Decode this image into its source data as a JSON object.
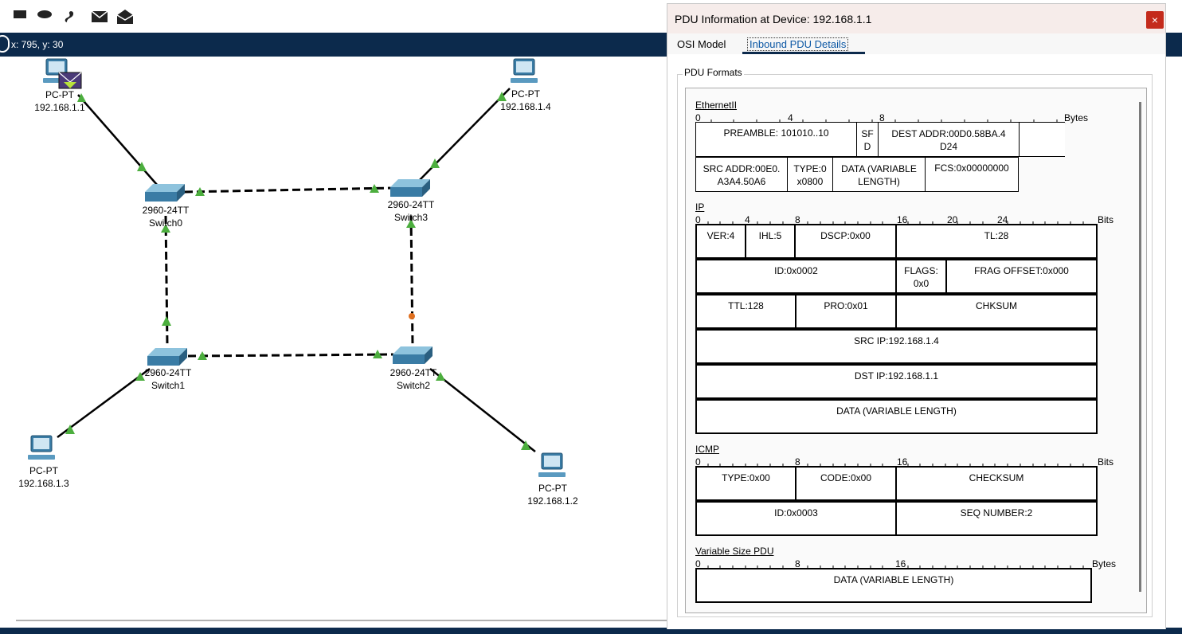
{
  "toolbar": {
    "icons": [
      "rectangle-icon",
      "ellipse-icon",
      "freeform-icon",
      "simple-pdu-icon",
      "complex-pdu-icon"
    ]
  },
  "status": {
    "coords": "x: 795, y: 30"
  },
  "devices": [
    {
      "type": "PC-PT",
      "ip": "192.168.1.1"
    },
    {
      "type": "PC-PT",
      "ip": "192.168.1.4"
    },
    {
      "type": "PC-PT",
      "ip": "192.168.1.3"
    },
    {
      "type": "PC-PT",
      "ip": "192.168.1.2"
    }
  ],
  "switches": [
    {
      "model": "2960-24TT",
      "name": "Switch0"
    },
    {
      "model": "2960-24TT",
      "name": "Switch3"
    },
    {
      "model": "2960-24TT",
      "name": "Switch1"
    },
    {
      "model": "2960-24TT",
      "name": "Switch2"
    }
  ],
  "colors": {
    "link_up": "#4cae3e",
    "link_blocking": "#e07020",
    "dark_bar": "#0c2a4c",
    "close": "#c42b1c"
  },
  "pdu": {
    "title": "PDU Information at Device: 192.168.1.1",
    "close": "×",
    "tabs": [
      "OSI Model",
      "Inbound PDU Details"
    ],
    "group": "PDU Formats",
    "ethernet": {
      "title": "EthernetII",
      "ruler": [
        "0",
        "4",
        "8"
      ],
      "unit": "Bytes",
      "fields": [
        "PREAMBLE: 101010..10",
        "SF\nD",
        "DEST ADDR:00D0.58BA.4\nD24",
        "",
        "SRC ADDR:00E0.\nA3A4.50A6",
        "TYPE:0\nx0800",
        "DATA (VARIABLE\nLENGTH)",
        "FCS:0x00000000"
      ]
    },
    "ip": {
      "title": "IP",
      "ruler": [
        "0",
        "4",
        "8",
        "16",
        "20",
        "24"
      ],
      "unit": "Bits",
      "fields": [
        "VER:4",
        "IHL:5",
        "DSCP:0x00",
        "TL:28",
        "ID:0x0002",
        "FLAGS:\n0x0",
        "FRAG OFFSET:0x000",
        "TTL:128",
        "PRO:0x01",
        "CHKSUM",
        "SRC IP:192.168.1.4",
        "DST IP:192.168.1.1",
        "DATA (VARIABLE LENGTH)"
      ]
    },
    "icmp": {
      "title": "ICMP",
      "ruler": [
        "0",
        "8",
        "16"
      ],
      "unit": "Bits",
      "fields": [
        "TYPE:0x00",
        "CODE:0x00",
        "CHECKSUM",
        "ID:0x0003",
        "SEQ NUMBER:2"
      ]
    },
    "varpdu": {
      "title": "Variable Size PDU",
      "ruler": [
        "0",
        "8",
        "16"
      ],
      "unit": "Bytes",
      "fields": [
        "DATA (VARIABLE LENGTH)"
      ]
    }
  }
}
